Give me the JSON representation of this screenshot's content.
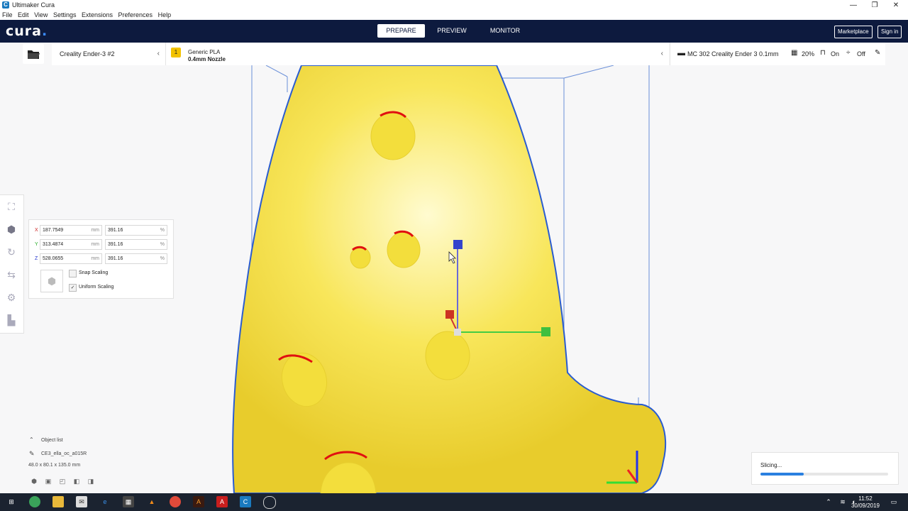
{
  "window": {
    "title": "Ultimaker Cura",
    "app_icon": "C",
    "controls": [
      "—",
      "❐",
      "✕"
    ]
  },
  "menu": [
    "File",
    "Edit",
    "View",
    "Settings",
    "Extensions",
    "Preferences",
    "Help"
  ],
  "header": {
    "logo": "cura",
    "tabs": [
      "PREPARE",
      "PREVIEW",
      "MONITOR"
    ],
    "active_tab": "PREPARE",
    "marketplace": "Marketplace",
    "signin": "Sign in"
  },
  "printer": {
    "name": "Creality Ender-3 #2",
    "extruder_number": "1",
    "material": "Generic PLA",
    "nozzle": "0.4mm Nozzle",
    "profile": "MC 302 Creality Ender 3 0.1mm",
    "infill": "20%",
    "support": "On",
    "adhesion": "Off"
  },
  "scale": {
    "x_label": "X",
    "x_mm": "187.7549",
    "x_pct": "391.16",
    "y_label": "Y",
    "y_mm": "313.4874",
    "y_pct": "391.16",
    "z_label": "Z",
    "z_mm": "528.0655",
    "z_pct": "391.16",
    "unit_mm": "mm",
    "unit_pct": "%",
    "snap_label": "Snap Scaling",
    "snap_checked": false,
    "uniform_label": "Uniform Scaling",
    "uniform_checked": true
  },
  "object_list": {
    "header": "Object list",
    "filename": "CE3_ella_oc_a015R",
    "dimensions": "48.0 x 80.1 x 135.0 mm"
  },
  "slicing": {
    "label": "Slicing...",
    "progress": 0.34
  },
  "taskbar": {
    "time": "11:52",
    "date": "30/09/2019"
  },
  "colors": {
    "header_bg": "#0d1a3e",
    "model_yellow": "#f7e04a",
    "overhang_red": "#e01010",
    "accent_blue": "#2a80e0"
  }
}
